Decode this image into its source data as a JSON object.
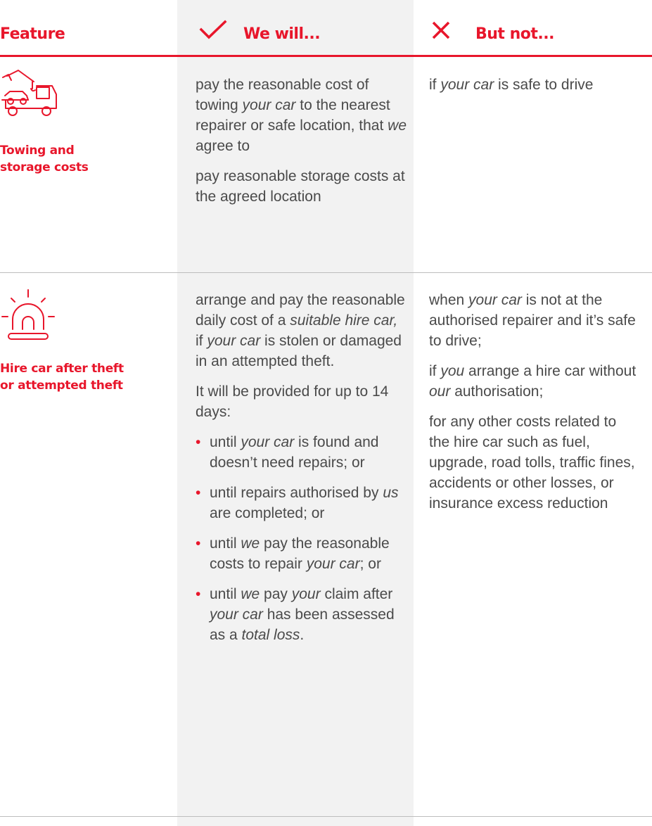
{
  "header": {
    "feature": "Feature",
    "we_will": "We will...",
    "but_not": "But not...",
    "check_icon": "check-icon",
    "cross_icon": "cross-icon"
  },
  "rows": [
    {
      "feature_icon": "tow-truck-icon",
      "feature_label_line1": "Towing and",
      "feature_label_line2": "storage costs",
      "we_will": [
        [
          "pay the reasonable cost of towing ",
          {
            "em": "your car"
          },
          " to the nearest repairer or safe location, that ",
          {
            "em": "we"
          },
          " agree to"
        ],
        [
          "pay reasonable storage costs at the agreed location"
        ]
      ],
      "but_not": [
        [
          "if ",
          {
            "em": "your car"
          },
          " is safe to drive"
        ]
      ]
    },
    {
      "feature_icon": "siren-icon",
      "feature_label_line1": "Hire car after theft",
      "feature_label_line2": "or attempted theft",
      "we_will": [
        [
          "arrange and pay the reasonable daily cost of a ",
          {
            "em": "suitable hire car,"
          },
          " if ",
          {
            "em": "your car"
          },
          " is stolen or damaged in an attempted theft."
        ],
        [
          "It will be provided for up to 14 days:"
        ]
      ],
      "we_will_bullets": [
        [
          "until ",
          {
            "em": "your car"
          },
          " is found and doesn’t need repairs; or"
        ],
        [
          "until repairs authorised by ",
          {
            "em": "us"
          },
          " are completed; or"
        ],
        [
          "until ",
          {
            "em": "we"
          },
          " pay the reasonable costs to repair ",
          {
            "em": "your car"
          },
          "; or"
        ],
        [
          "until ",
          {
            "em": "we"
          },
          " pay ",
          {
            "em": "your"
          },
          " claim after ",
          {
            "em": "your car"
          },
          " has been assessed as a ",
          {
            "em": "total loss"
          },
          "."
        ]
      ],
      "but_not": [
        [
          "when ",
          {
            "em": "your car"
          },
          " is not at the authorised repairer and it’s safe to drive;"
        ],
        [
          "if ",
          {
            "em": "you"
          },
          " arrange a hire car without ",
          {
            "em": "our"
          },
          " authorisation;"
        ],
        [
          "for any other costs related to the hire car such as fuel, upgrade, road tolls, traffic fines, accidents or other losses, or insurance excess reduction"
        ]
      ]
    }
  ],
  "colors": {
    "accent": "#e8162b",
    "text": "#4a4a4a",
    "shade": "#f2f2f2",
    "divider": "#bdbdbd"
  }
}
